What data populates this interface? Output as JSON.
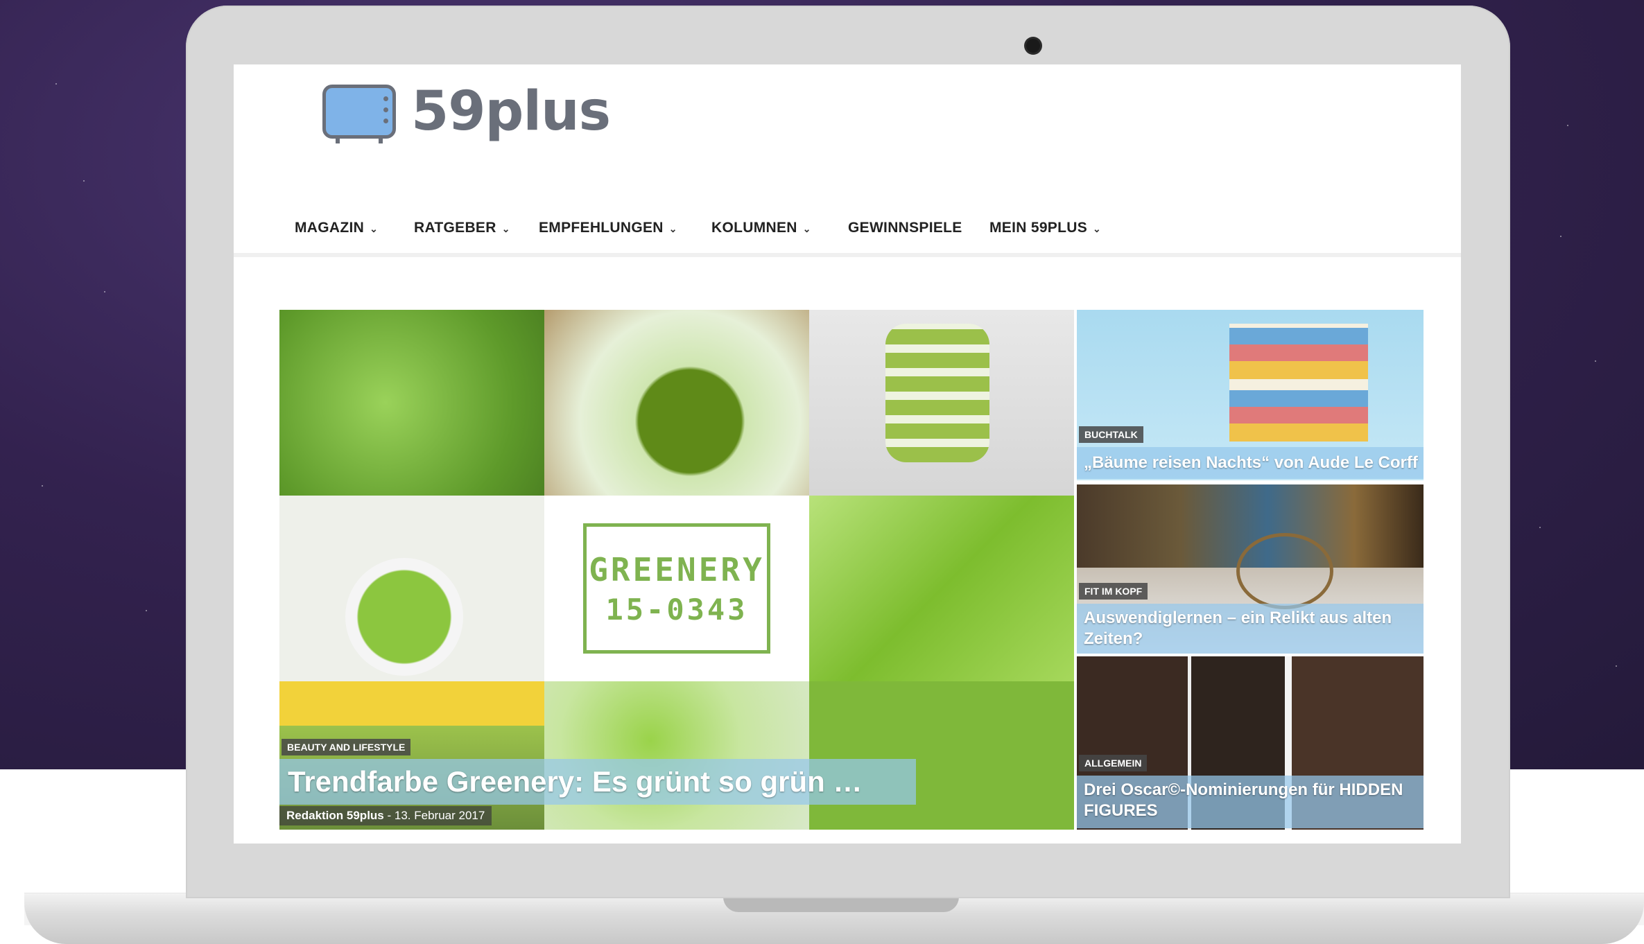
{
  "site": {
    "logo_text": "59plus"
  },
  "nav": {
    "items": [
      {
        "label": "MAGAZIN",
        "dropdown": true
      },
      {
        "label": "RATGEBER",
        "dropdown": true
      },
      {
        "label": "EMPFEHLUNGEN",
        "dropdown": true
      },
      {
        "label": "KOLUMNEN",
        "dropdown": true
      },
      {
        "label": "GEWINNSPIELE",
        "dropdown": false
      },
      {
        "label": "MEIN 59PLUS",
        "dropdown": true
      }
    ]
  },
  "featured": {
    "category": "BEAUTY AND LIFESTYLE",
    "title": "Trendfarbe Greenery: Es grünt so grün …",
    "author": "Redaktion 59plus",
    "date": "- 13. Februar 2017",
    "swatch_line1": "GREENERY",
    "swatch_line2": "15-0343"
  },
  "side_posts": [
    {
      "category": "BUCHTALK",
      "title": "„Bäume reisen Nachts“ von Aude Le Corff"
    },
    {
      "category": "FIT IM KOPF",
      "title": "Auswendiglernen – ein Relikt aus alten Zeiten?"
    },
    {
      "category": "ALLGEMEIN",
      "title": "Drei Oscar©-Nominierungen für HIDDEN FIGURES"
    }
  ],
  "colors": {
    "greenery": "#88b04b",
    "caption_overlay": "#96c8eb",
    "sky": "#33224f"
  }
}
